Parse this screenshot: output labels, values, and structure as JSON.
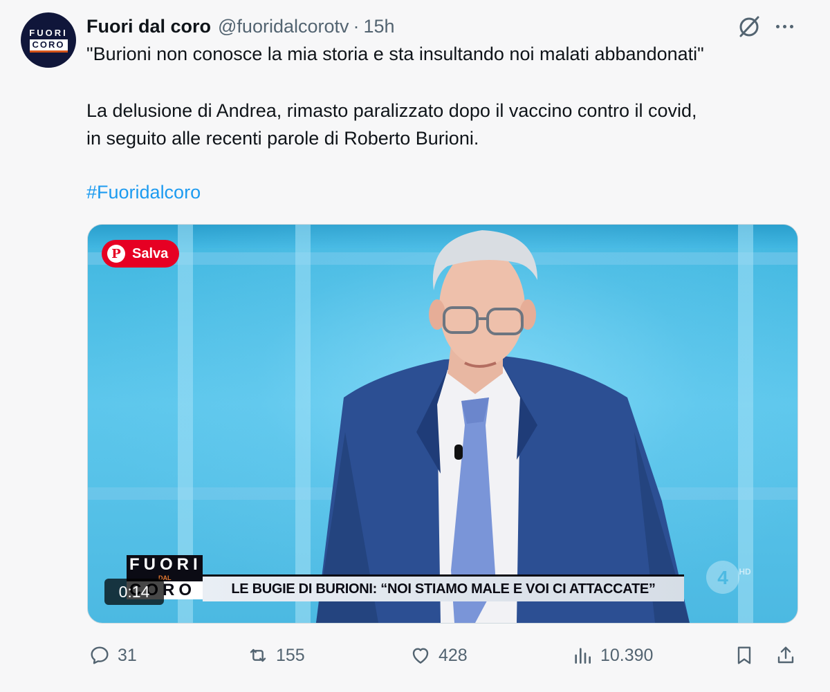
{
  "author": {
    "avatar_top": "FUORI",
    "avatar_bottom": "CORO",
    "name": "Fuori dal coro",
    "handle": "@fuoridalcorotv",
    "separator": "·",
    "time": "15h"
  },
  "tweet": {
    "line1": "\"Burioni non conosce la mia storia e sta insultando noi malati abbandonati\"",
    "line2": "La delusione di Andrea, rimasto paralizzato dopo il vaccino contro il covid,",
    "line3": "in seguito alle recenti parole di Roberto Burioni.",
    "hashtag": "#Fuoridalcoro"
  },
  "media": {
    "save_button": "Salva",
    "save_icon": "pinterest-icon",
    "banner_logo_top": "FUORI",
    "banner_logo_mid": "DAL",
    "banner_logo_bottom": "CORO",
    "banner_text": "LE BUGIE DI BURIONI: “NOI STIAMO MALE E VOI CI ATTACCATE”",
    "channel_badge": "HD",
    "duration": "0:14"
  },
  "actions": {
    "replies": "31",
    "reposts": "155",
    "likes": "428",
    "views": "10.390"
  },
  "colors": {
    "link": "#1d9bf0",
    "muted": "#536471",
    "pinterest": "#e60023"
  }
}
